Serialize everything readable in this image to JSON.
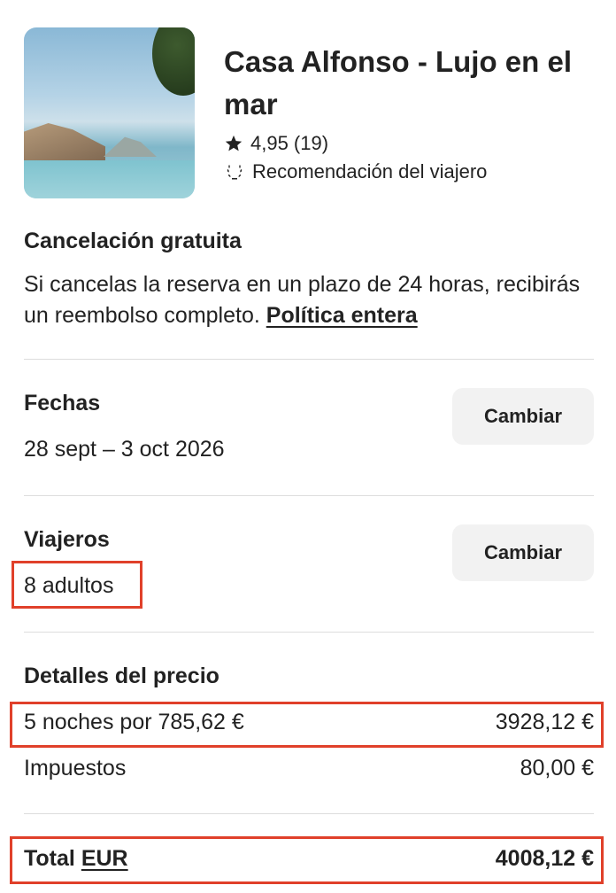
{
  "listing": {
    "image_icon": "pool-photo",
    "title": "Casa Alfonso - Lujo en el mar",
    "rating_icon": "star-icon",
    "rating": "4,95 (19)",
    "badge_icon": "laurel-icon",
    "badge": "Recomendación del viajero"
  },
  "cancellation": {
    "title": "Cancelación gratuita",
    "text": "Si cancelas la reserva en un plazo de 24 horas, recibirás un reembolso completo.",
    "link": "Política entera"
  },
  "dates": {
    "title": "Fechas",
    "value": "28 sept – 3 oct 2026",
    "button": "Cambiar"
  },
  "travelers": {
    "title": "Viajeros",
    "value": "8 adultos",
    "button": "Cambiar"
  },
  "price": {
    "title": "Detalles del precio",
    "nights_label": "5 noches por 785,62 €",
    "nights_amount": "3928,12 €",
    "taxes_label": "Impuestos",
    "taxes_amount": "80,00 €",
    "total_label": "Total",
    "total_currency": "EUR",
    "total_amount": "4008,12 €"
  },
  "colors": {
    "highlight": "#e0402a",
    "button_bg": "#f2f2f2",
    "text": "#222222",
    "divider": "#dddddd"
  }
}
